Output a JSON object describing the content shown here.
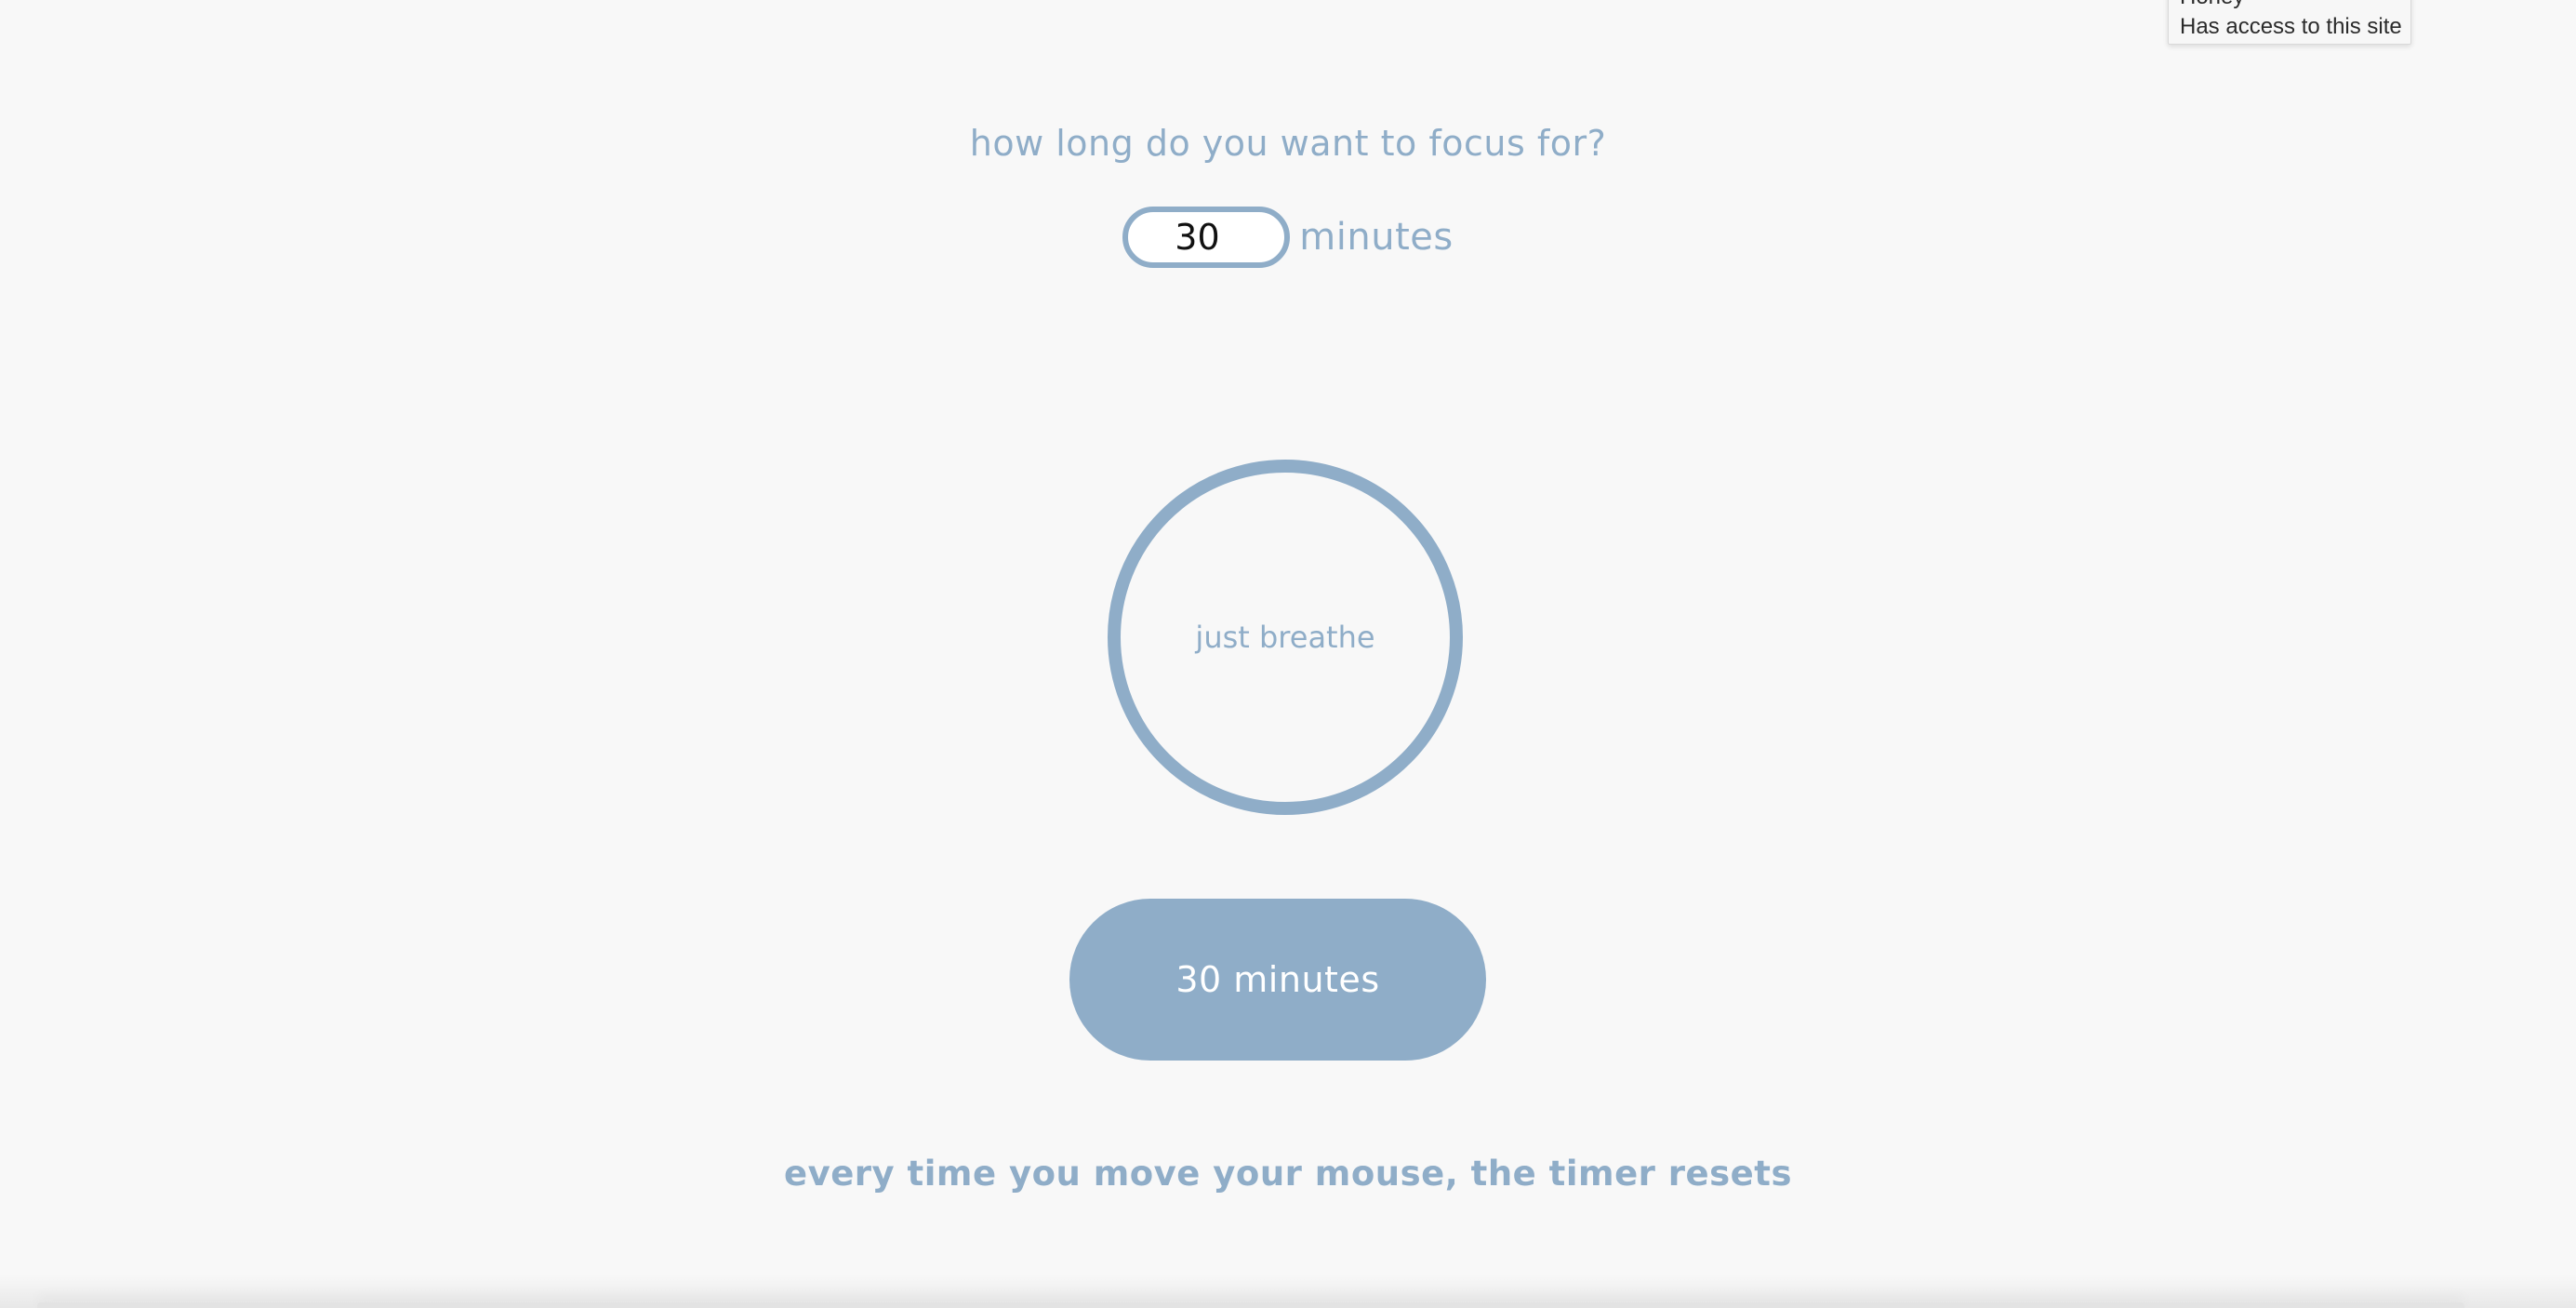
{
  "extension_tooltip": {
    "name": "Honey",
    "status": "Has access to this site"
  },
  "focus": {
    "question": "how long do you want to focus for?",
    "duration_value": "30",
    "duration_unit": "minutes",
    "circle_label": "just breathe",
    "timer_button_label": "30 minutes",
    "hint": "every time you move your mouse, the timer resets"
  },
  "colors": {
    "accent": "#8fadc8",
    "background": "#f8f8f8",
    "button_text": "#ffffff"
  }
}
